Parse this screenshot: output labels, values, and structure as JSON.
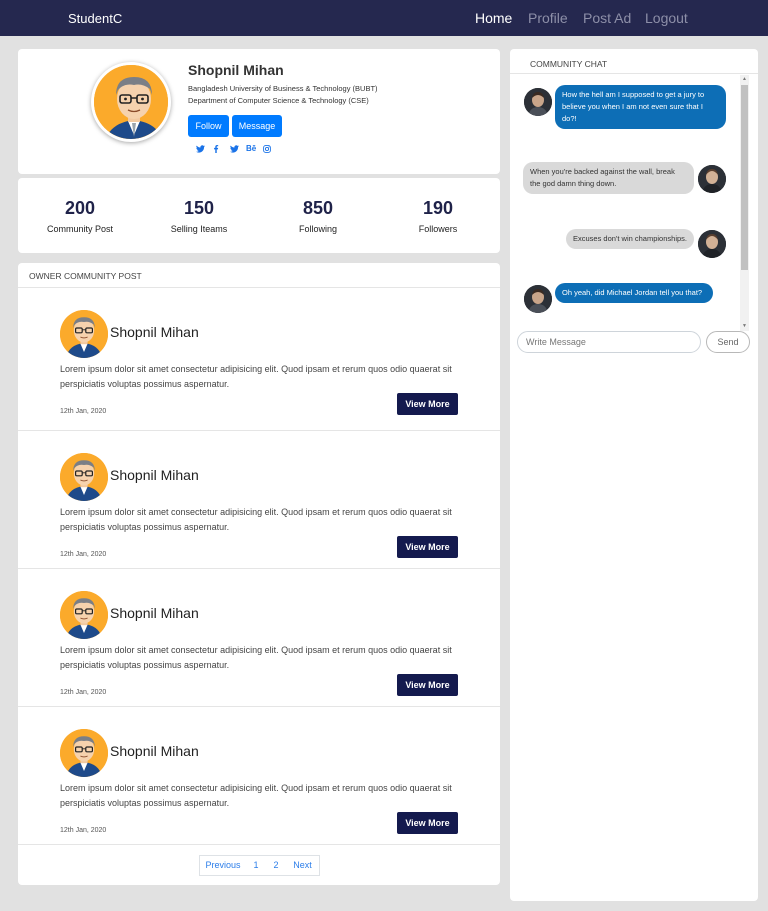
{
  "nav": {
    "brand": "StudentC",
    "links": [
      "Home",
      "Profile",
      "Post Ad",
      "Logout"
    ]
  },
  "profile": {
    "name": "Shopnil Mihan",
    "university": "Bangladesh University of Business & Technology (BUBT)",
    "department": "Department of Computer Science & Technology (CSE)",
    "follow_label": "Follow",
    "message_label": "Message",
    "socials": [
      "twitter-icon",
      "facebook-icon",
      "twitter-icon",
      "behance-icon",
      "instagram-icon"
    ]
  },
  "stats": [
    {
      "value": "200",
      "label": "Community Post"
    },
    {
      "value": "150",
      "label": "Selling Iteams"
    },
    {
      "value": "850",
      "label": "Following"
    },
    {
      "value": "190",
      "label": "Followers"
    }
  ],
  "posts_section": {
    "title": "OWNER COMMUNITY POST",
    "posts": [
      {
        "author": "Shopnil Mihan",
        "text": "Lorem ipsum dolor sit amet consectetur adipisicing elit. Quod ipsam et rerum quos odio quaerat sit perspiciatis voluptas possimus aspernatur.",
        "date": "12th Jan, 2020",
        "button": "View More"
      },
      {
        "author": "Shopnil Mihan",
        "text": "Lorem ipsum dolor sit amet consectetur adipisicing elit. Quod ipsam et rerum quos odio quaerat sit perspiciatis voluptas possimus aspernatur.",
        "date": "12th Jan, 2020",
        "button": "View More"
      },
      {
        "author": "Shopnil Mihan",
        "text": "Lorem ipsum dolor sit amet consectetur adipisicing elit. Quod ipsam et rerum quos odio quaerat sit perspiciatis voluptas possimus aspernatur.",
        "date": "12th Jan, 2020",
        "button": "View More"
      },
      {
        "author": "Shopnil Mihan",
        "text": "Lorem ipsum dolor sit amet consectetur adipisicing elit. Quod ipsam et rerum quos odio quaerat sit perspiciatis voluptas possimus aspernatur.",
        "date": "12th Jan, 2020",
        "button": "View More"
      }
    ],
    "pagination": [
      "Previous",
      "1",
      "2",
      "Next"
    ]
  },
  "chat": {
    "title": "COMMUNITY CHAT",
    "messages": [
      {
        "text": "How the hell am I supposed to get a jury to believe you when I am not even sure that I do?!",
        "direction": "out"
      },
      {
        "text": "When you're backed against the wall, break the god damn thing down.",
        "direction": "in"
      },
      {
        "text": "Excuses don't win championships.",
        "direction": "in"
      },
      {
        "text": "Oh yeah, did Michael Jordan tell you that?",
        "direction": "out"
      }
    ],
    "input_placeholder": "Write Message",
    "send_label": "Send"
  }
}
